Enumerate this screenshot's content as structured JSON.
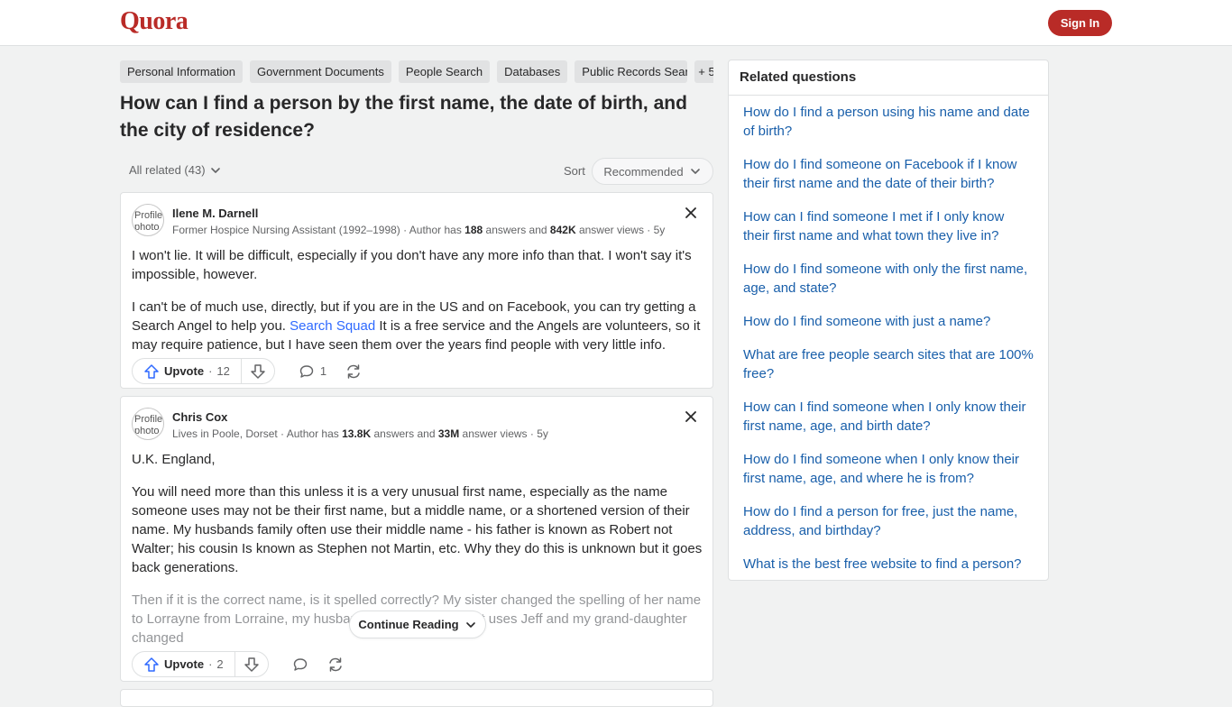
{
  "header": {
    "logo": "Quora",
    "signin_label": "Sign In"
  },
  "topics": [
    "Personal Information",
    "Government Documents",
    "People Search",
    "Databases",
    "Public Records Search",
    "+ 5"
  ],
  "question": {
    "title": "How can I find a person by the first name, the date of birth, and the city of residence?"
  },
  "controls": {
    "all_related": "All related (43)",
    "sort_label": "Sort",
    "sort_value": "Recommended"
  },
  "answers": [
    {
      "avatar_alt": "Profile photo for Ilene M. Darnell",
      "author": "Ilene M. Darnell",
      "cred_prefix": "Former Hospice Nursing Assistant (1992–1998) · Author has ",
      "answers_count": "188",
      "cred_mid": " answers and ",
      "views_count": "842K",
      "cred_suffix": " answer views · 5y",
      "p1": "I won't lie. It will be difficult, especially if you don't have any more info than that. I won't say it's impossible, however.",
      "p2_a": "I can't be of much use, directly, but if you are in the US and on Facebook, you can try getting a Search Angel to help you. ",
      "p2_link": "Search Squad",
      "p2_b": " It is a free service and the Angels are volunteers, so it may require patience, but I have seen them over the years find people with very little info.",
      "upvote_label": "Upvote",
      "upvote_count": "12",
      "comment_count": "1"
    },
    {
      "avatar_alt": "Profile photo for Chris Cox",
      "author": "Chris Cox",
      "cred_prefix": "Lives in Poole, Dorset · Author has ",
      "answers_count": "13.8K",
      "cred_mid": " answers and ",
      "views_count": "33M",
      "cred_suffix": " answer views · 5y",
      "p1": "U.K. England,",
      "p2": "You will need more than this unless it is a very unusual first name, especially as the name someone uses may not be their first name, but a middle name, or a shortened version of their name. My husbands family often use their middle name - his father is known as Robert not Walter; his cousin Is known as Stephen not Martin, etc. Why they do this is unknown but it goes back generations.",
      "p3": "Then if it is the correct name, is it spelled correctly? My sister changed the spelling of her name to Lorrayne from Lorraine, my husband is called Jeffrey but uses Jeff and my grand-daughter changed",
      "continue_label": "Continue Reading",
      "upvote_label": "Upvote",
      "upvote_count": "2"
    }
  ],
  "related": {
    "title": "Related questions",
    "items": [
      "How do I find a person using his name and date of birth?",
      "How do I find someone on Facebook if I know their first name and the date of their birth?",
      "How can I find someone I met if I only know their first name and what town they live in?",
      "How do I find someone with only the first name, age, and state?",
      "How do I find someone with just a name?",
      "What are free people search sites that are 100% free?",
      "How can I find someone when I only know their first name, age, and birth date?",
      "How do I find someone when I only know their first name, age, and where he is from?",
      "How do I find a person for free, just the name, address, and birthday?",
      "What is the best free website to find a person?"
    ]
  },
  "colors": {
    "brand": "#b92b27",
    "link": "#195faa",
    "accent": "#2e69ff"
  }
}
